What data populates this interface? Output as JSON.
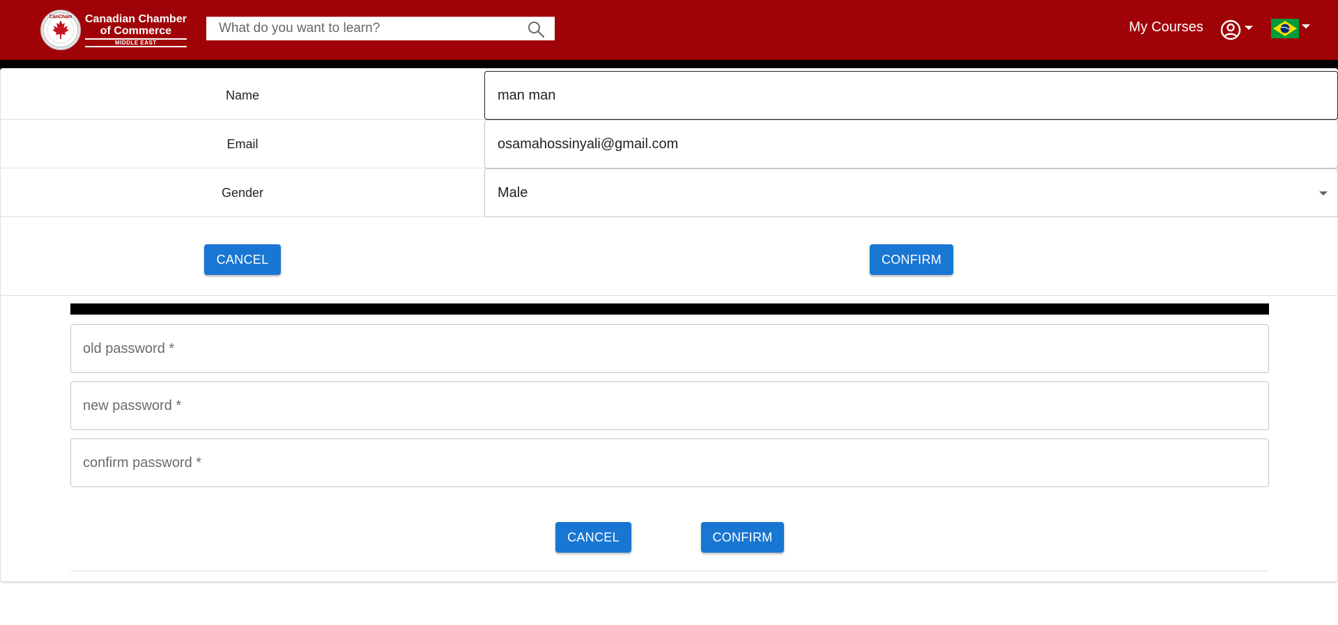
{
  "header": {
    "logo": {
      "seal_text": "CanCham",
      "line1": "Canadian Chamber",
      "line2": "of Commerce",
      "line3": "MIDDLE EAST"
    },
    "search": {
      "placeholder": "What do you want to learn?"
    },
    "my_courses": "My Courses",
    "colors": {
      "header_bg": "#a00307",
      "accent": "#1976d2"
    }
  },
  "profile": {
    "rows": [
      {
        "label": "Name",
        "value": "man man"
      },
      {
        "label": "Email",
        "value": "osamahossinyali@gmail.com"
      },
      {
        "label": "Gender",
        "value": "Male"
      }
    ],
    "cancel_label": "CANCEL",
    "confirm_label": "CONFIRM"
  },
  "password": {
    "old_placeholder": "old password *",
    "new_placeholder": "new password *",
    "confirm_placeholder": "confirm password *",
    "cancel_label": "CANCEL",
    "confirm_label": "CONFIRM"
  }
}
